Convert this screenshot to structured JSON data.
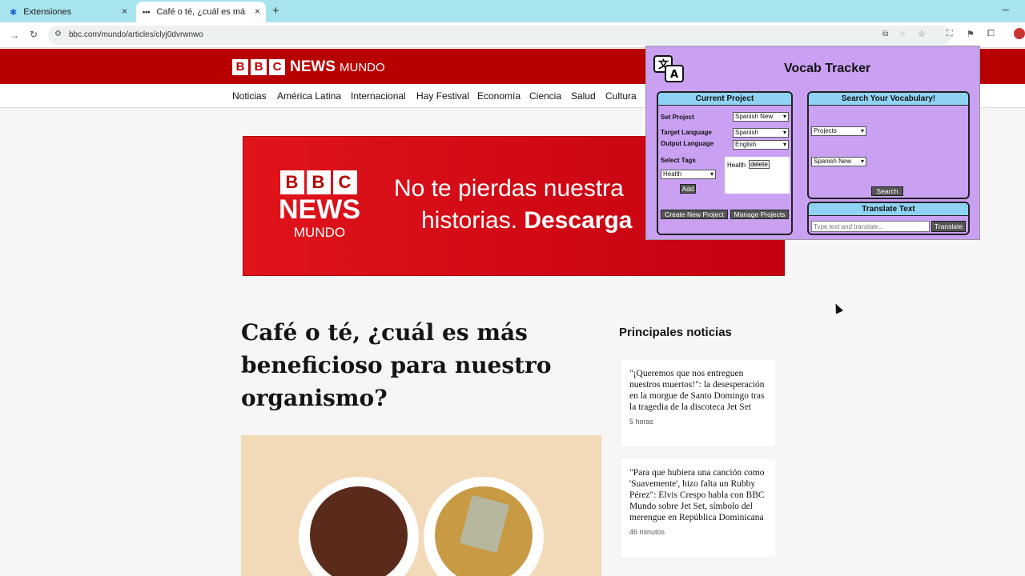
{
  "browser": {
    "tabs": [
      {
        "title": "Extensiones"
      },
      {
        "title": "Café o té, ¿cuál es más b"
      }
    ],
    "url": "bbc.com/mundo/articles/clyj0dvrwnwo"
  },
  "bbc": {
    "logo_news": "NEWS",
    "logo_mundo": "MUNDO",
    "nav": [
      "Noticias",
      "América Latina",
      "Internacional",
      "Hay Festival",
      "Economía",
      "Ciencia",
      "Salud",
      "Cultura"
    ],
    "banner": {
      "line1": "No te pierdas nuestra",
      "line2_plain": "historias. ",
      "line2_bold": "Descarga",
      "logo_news": "NEWS",
      "logo_mundo": "MUNDO"
    },
    "headline": "Café o té, ¿cuál es más beneficioso para nuestro organismo?",
    "principales_title": "Principales noticias",
    "cards": [
      {
        "title": "\"¡Queremos que nos entreguen nuestros muertos!\": la desesperación en la morgue de Santo Domingo tras la tragedia de la discoteca Jet Set",
        "time": "5 horas"
      },
      {
        "title": "\"Para que hubiera una canción como 'Suavemente', hizo falta un Rubby Pérez\": Elvis Crespo habla con BBC Mundo sobre Jet Set, símbolo del merengue en República Dominicana",
        "time": "46 minutos"
      }
    ]
  },
  "popup": {
    "title": "Vocab Tracker",
    "current_project": {
      "header": "Current Project",
      "set_project_label": "Set Project",
      "set_project_value": "Spanish New",
      "target_language_label": "Target Language",
      "target_language_value": "Spanish",
      "output_language_label": "Output Language",
      "output_language_value": "English",
      "select_tags_label": "Select Tags",
      "tag_select_value": "Health",
      "add_button": "Add",
      "tag_item": "Health",
      "delete_button": "delete",
      "create_button": "Create New Project",
      "manage_button": "Manage Projects"
    },
    "search": {
      "header": "Search Your Vocabulary!",
      "select1_value": "Projects",
      "select2_value": "Spanish New",
      "search_button": "Search"
    },
    "translate": {
      "header": "Translate Text",
      "placeholder": "Type text and translate...",
      "button": "Translate"
    }
  }
}
